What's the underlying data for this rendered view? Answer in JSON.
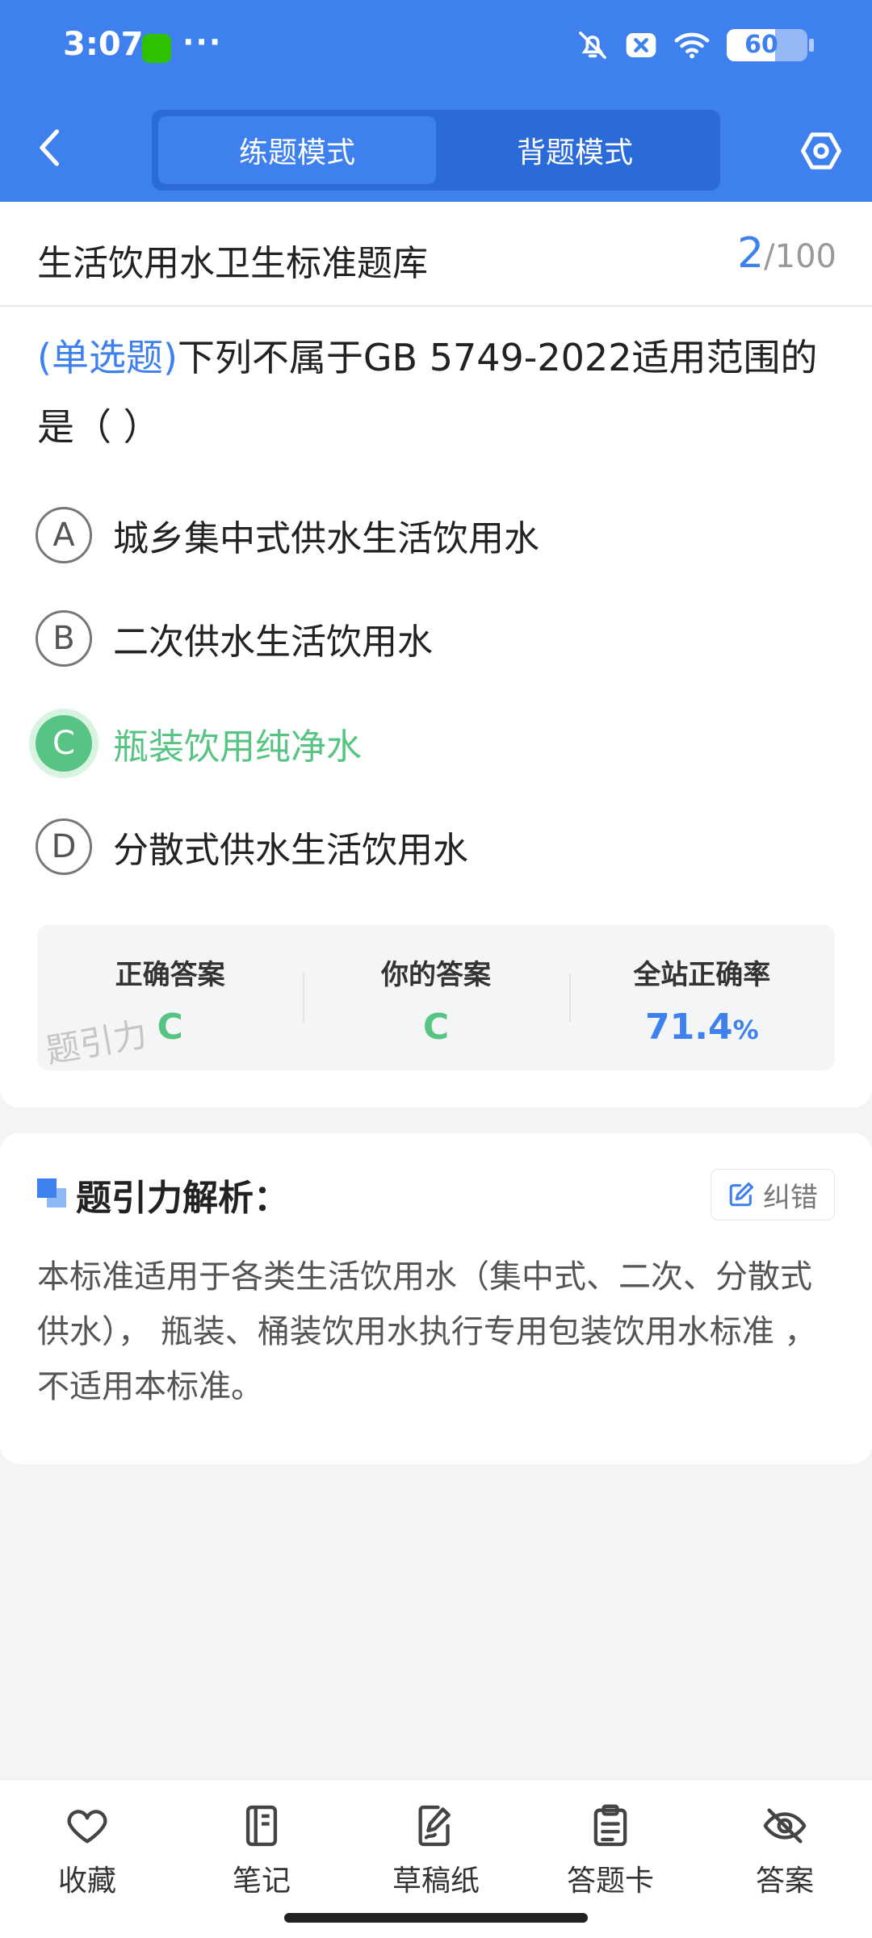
{
  "status_bar": {
    "time": "3:07",
    "dots": "···",
    "battery": "60"
  },
  "header": {
    "modes": [
      {
        "label": "练题模式",
        "active": true
      },
      {
        "label": "背题模式",
        "active": false
      }
    ]
  },
  "bank": {
    "title": "生活饮用水卫生标准题库",
    "current": "2",
    "total": "/100"
  },
  "question": {
    "type": "(单选题)",
    "text": "下列不属于GB 5749-2022适用范围的是（        ）",
    "options": [
      {
        "letter": "A",
        "text": "城乡集中式供水生活饮用水"
      },
      {
        "letter": "B",
        "text": "二次供水生活饮用水"
      },
      {
        "letter": "C",
        "text": "瓶装饮用纯净水",
        "selected": true
      },
      {
        "letter": "D",
        "text": "分散式供水生活饮用水"
      }
    ]
  },
  "stats": {
    "correct_label": "正确答案",
    "correct_value": "C",
    "yours_label": "你的答案",
    "yours_value": "C",
    "rate_label": "全站正确率",
    "rate_value": "71.4",
    "rate_unit": "%",
    "watermark": "题引力"
  },
  "analysis": {
    "title": "题引力解析：",
    "correction_label": "纠错",
    "body": "本标准适用于各类生活饮用水（集中式、二次、分散式供水）， 瓶装、桶装饮用水执行专用包装饮用水标准 ，不适用本标准。"
  },
  "bottom_nav": [
    {
      "label": "收藏",
      "icon": "heart-icon"
    },
    {
      "label": "笔记",
      "icon": "notebook-icon"
    },
    {
      "label": "草稿纸",
      "icon": "scratch-paper-icon"
    },
    {
      "label": "答题卡",
      "icon": "answer-card-icon"
    },
    {
      "label": "答案",
      "icon": "eye-off-icon"
    }
  ],
  "colors": {
    "primary": "#3e80ee",
    "correct": "#58c483"
  }
}
